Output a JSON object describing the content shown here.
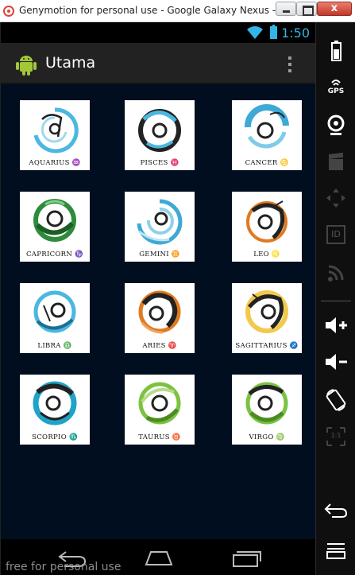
{
  "window": {
    "title": "Genymotion for personal use - Google Galaxy Nexus - 4.1...",
    "close_label": "x"
  },
  "status_bar": {
    "time": "1:50"
  },
  "action_bar": {
    "title": "Utama"
  },
  "zodiac": [
    {
      "label": "Aquarius ♒",
      "display": "AQUARIUS ♒",
      "accent": "#4ab8e0"
    },
    {
      "label": "Pisces ♓",
      "display": "PISCES ♓",
      "accent": "#222222"
    },
    {
      "label": "Cancer ♋",
      "display": "CANCER ♋",
      "accent": "#3fa9d6"
    },
    {
      "label": "Capricorn ♑",
      "display": "CAPRICORN ♑",
      "accent": "#2e8b3d"
    },
    {
      "label": "Gemini ♊",
      "display": "GEMINI ♊",
      "accent": "#3fa9d6"
    },
    {
      "label": "Leo ♌",
      "display": "LEO ♌",
      "accent": "#e07a20"
    },
    {
      "label": "Libra ♎",
      "display": "LIBRA ♎",
      "accent": "#4ab8e0"
    },
    {
      "label": "Aries ♈",
      "display": "ARIES ♈",
      "accent": "#e07a20"
    },
    {
      "label": "Sagittarius ♐",
      "display": "SAGITTARIUS ♐",
      "accent": "#f2c94c"
    },
    {
      "label": "Scorpio ♏",
      "display": "SCORPIO ♏",
      "accent": "#1fa3c9"
    },
    {
      "label": "Taurus ♉",
      "display": "TAURUS ♉",
      "accent": "#7cc242"
    },
    {
      "label": "Virgo ♍",
      "display": "VIRGO ♍",
      "accent": "#7cc242"
    }
  ],
  "nav_bar": {
    "watermark": "free for personal use"
  },
  "sidebar": {
    "gps_label": "GPS",
    "id_label": "ID",
    "scale_label": "1:1"
  },
  "colors": {
    "accent_blue": "#33b5e5",
    "content_bg": "#010e1f",
    "action_bar": "#222222"
  }
}
